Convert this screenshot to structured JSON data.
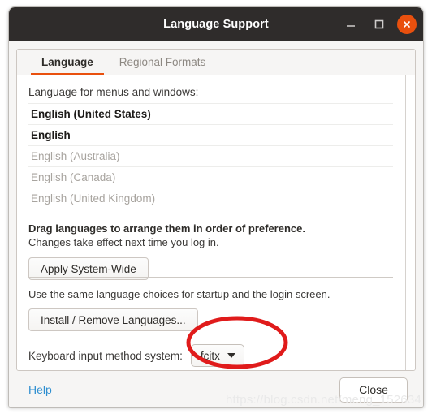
{
  "window": {
    "title": "Language Support",
    "controls": {
      "minimize": "minimize-icon",
      "maximize": "maximize-icon",
      "close": "close-icon"
    },
    "accent_color": "#e9500e",
    "titlebar_color": "#2f2c2b"
  },
  "tabs": [
    {
      "label": "Language",
      "active": true
    },
    {
      "label": "Regional Formats",
      "active": false
    }
  ],
  "language_tab": {
    "list_label": "Language for menus and windows:",
    "languages": [
      {
        "label": "English (United States)",
        "state": "enabled"
      },
      {
        "label": "English",
        "state": "enabled"
      },
      {
        "label": "English (Australia)",
        "state": "disabled"
      },
      {
        "label": "English (Canada)",
        "state": "disabled"
      },
      {
        "label": "English (United Kingdom)",
        "state": "disabled"
      }
    ],
    "drag_hint": "Drag languages to arrange them in order of preference.",
    "changes_hint": "Changes take effect next time you log in.",
    "apply_button": "Apply System-Wide",
    "apply_hint": "Use the same language choices for startup and the login screen.",
    "install_button": "Install / Remove Languages...",
    "input_method": {
      "label": "Keyboard input method system:",
      "value": "fcitx",
      "caret_icon": "chevron-down-icon"
    }
  },
  "action_bar": {
    "help": "Help",
    "close": "Close"
  },
  "annotation": {
    "shape": "ellipse",
    "color": "#e01b1b",
    "target": "keyboard-input-method-dropdown"
  },
  "watermark": {
    "text": "https://blog.csdn.net/meng_152634"
  }
}
